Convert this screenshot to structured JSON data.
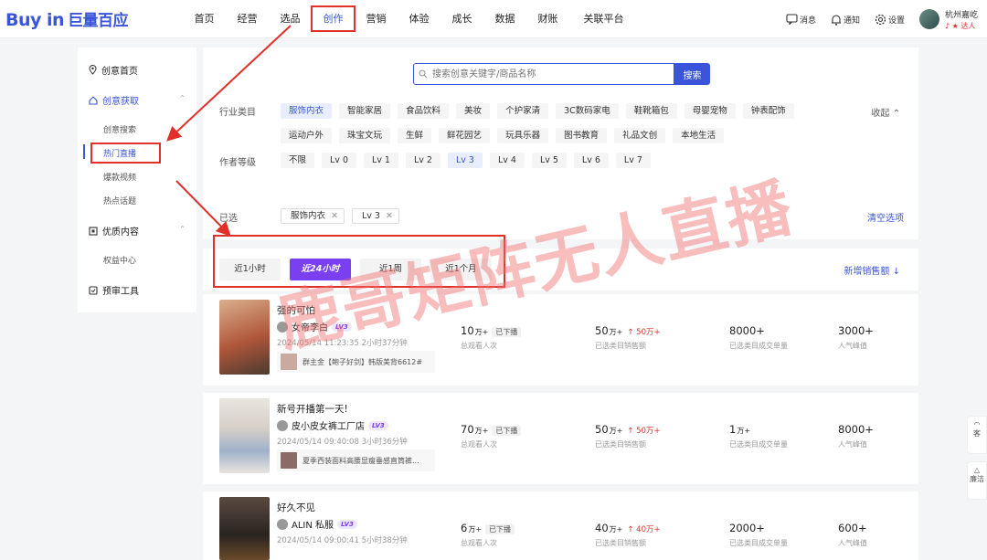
{
  "logo": {
    "latin": "Buy in",
    "cn": "巨量百应"
  },
  "nav": [
    "首页",
    "经营",
    "选品",
    "创作",
    "营销",
    "体验",
    "成长",
    "数据",
    "财账",
    "关联平台"
  ],
  "top_right": {
    "messages": "消息",
    "notify": "通知",
    "settings": "设置",
    "username": "杭州嘉屹",
    "user_tag": "达人"
  },
  "sidebar": {
    "home": "创意首页",
    "acquire": "创意获取",
    "acquire_subs": [
      "创意搜索",
      "热门直播",
      "爆款视频",
      "热点话题"
    ],
    "quality": "优质内容",
    "quality_subs": [
      "权益中心"
    ],
    "review": "预审工具"
  },
  "search": {
    "placeholder": "搜索创意关键字/商品名称",
    "button": "搜索"
  },
  "filters": {
    "industry_label": "行业类目",
    "industry_row1": [
      "服饰内衣",
      "智能家居",
      "食品饮料",
      "美妆",
      "个护家清",
      "3C数码家电",
      "鞋靴箱包",
      "母婴宠物",
      "钟表配饰"
    ],
    "industry_row2": [
      "运动户外",
      "珠宝文玩",
      "生鲜",
      "鲜花园艺",
      "玩具乐器",
      "图书教育",
      "礼品文创",
      "本地生活"
    ],
    "collapse": "收起",
    "level_label": "作者等级",
    "levels": [
      "不限",
      "Lv 0",
      "Lv 1",
      "Lv 2",
      "Lv 3",
      "Lv 4",
      "Lv 5",
      "Lv 6",
      "Lv 7"
    ],
    "selected_label": "已选",
    "selected": [
      "服饰内衣",
      "Lv 3"
    ],
    "clear": "清空选项"
  },
  "time_tabs": [
    "近1小时",
    "近24小时",
    "近1周",
    "近1个月"
  ],
  "sort_label": "新增销售额",
  "stat_labels": [
    "总观看人次",
    "已选类目销售额",
    "已选类目成交单量",
    "人气峰值"
  ],
  "cards": [
    {
      "title": "强的可怕",
      "author": "女帝李白",
      "lv": "LV3",
      "time": "2024/05/14 11:23:35  2小时37分钟",
      "product": "群主金【鲍子好剑】韩版美背6612#",
      "s1": "10",
      "s1u": "万+",
      "s1badge": "已下播",
      "s2": "50",
      "s2u": "万+",
      "s2up": "50万+",
      "s3": "8000+",
      "s4": "3000+"
    },
    {
      "title": "新号开播第一天!",
      "author": "皮小皮女裤工厂店",
      "lv": "LV3",
      "time": "2024/05/14 09:40:08  3小时36分钟",
      "product": "夏季西装面料高腰显瘦垂感直筒裤...",
      "s1": "70",
      "s1u": "万+",
      "s1badge": "已下播",
      "s2": "50",
      "s2u": "万+",
      "s2up": "50万+",
      "s3": "1",
      "s3u": "万+",
      "s4": "8000+"
    },
    {
      "title": "好久不见",
      "author": "ALIN 私服",
      "lv": "LV3",
      "time": "2024/05/14 09:00:41  5小时38分钟",
      "product": "",
      "s1": "6",
      "s1u": "万+",
      "s1badge": "已下播",
      "s2": "40",
      "s2u": "万+",
      "s2up": "40万+",
      "s3": "2000+",
      "s4": "600+"
    }
  ],
  "float": [
    "客",
    "廉洁"
  ],
  "watermark": "鹿哥矩阵无人直播",
  "colors": {
    "brand": "#3a55d9",
    "accent_purple": "#7b3ff2",
    "annotation_red": "#e0302a"
  }
}
